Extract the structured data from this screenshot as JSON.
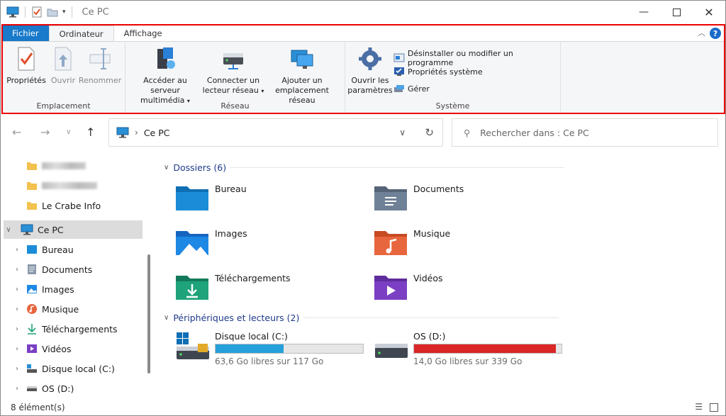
{
  "window": {
    "title": "Ce PC",
    "controls": [
      "minimize",
      "maximize",
      "close"
    ]
  },
  "ribbon": {
    "tabs": [
      {
        "label": "Fichier",
        "state": "file"
      },
      {
        "label": "Ordinateur",
        "state": "active"
      },
      {
        "label": "Affichage",
        "state": ""
      }
    ],
    "groups": {
      "emplacement": {
        "name": "Emplacement",
        "buttons": [
          {
            "label": "Propriétés",
            "icon": "properties-icon",
            "enabled": true
          },
          {
            "label": "Ouvrir",
            "icon": "open-icon",
            "enabled": false
          },
          {
            "label": "Renommer",
            "icon": "rename-icon",
            "enabled": false
          }
        ]
      },
      "reseau": {
        "name": "Réseau",
        "media_line1": "Accéder au serveur",
        "media_line2": "multimédia",
        "map_line1": "Connecter un",
        "map_line2": "lecteur réseau",
        "add_line1": "Ajouter un",
        "add_line2": "emplacement réseau"
      },
      "systeme": {
        "name": "Système",
        "settings_line1": "Ouvrir les",
        "settings_line2": "paramètres",
        "uninstall": "Désinstaller ou modifier un programme",
        "sysprops": "Propriétés système",
        "manage": "Gérer"
      }
    }
  },
  "address": {
    "location": "Ce PC",
    "search_placeholder": "Rechercher dans : Ce PC"
  },
  "sidebar": {
    "pinned_visible": "Le Crabe Info",
    "this_pc": "Ce PC",
    "items": [
      {
        "label": "Bureau",
        "icon": "desktop-icon"
      },
      {
        "label": "Documents",
        "icon": "documents-icon"
      },
      {
        "label": "Images",
        "icon": "images-icon"
      },
      {
        "label": "Musique",
        "icon": "music-icon"
      },
      {
        "label": "Téléchargements",
        "icon": "downloads-icon"
      },
      {
        "label": "Vidéos",
        "icon": "videos-icon"
      },
      {
        "label": "Disque local (C:)",
        "icon": "drive-c-icon"
      },
      {
        "label": "OS (D:)",
        "icon": "drive-d-icon"
      }
    ]
  },
  "content": {
    "folders_heading": "Dossiers (6)",
    "folders": [
      {
        "label": "Bureau",
        "color": "#1a8cd8"
      },
      {
        "label": "Documents",
        "color": "#6f8196"
      },
      {
        "label": "Images",
        "color": "#1e88e5"
      },
      {
        "label": "Musique",
        "color": "#e8663d"
      },
      {
        "label": "Téléchargements",
        "color": "#1fa37a"
      },
      {
        "label": "Vidéos",
        "color": "#7b3fc4"
      }
    ],
    "drives_heading": "Périphériques et lecteurs (2)",
    "drives": [
      {
        "label": "Disque local (C:)",
        "free": "63,6 Go libres sur 117 Go",
        "used_fraction": 0.46,
        "color": "#26a0da"
      },
      {
        "label": "OS (D:)",
        "free": "14,0 Go libres sur 339 Go",
        "used_fraction": 0.96,
        "color": "#da2626"
      }
    ]
  },
  "status": {
    "count": "8 élément(s)"
  }
}
